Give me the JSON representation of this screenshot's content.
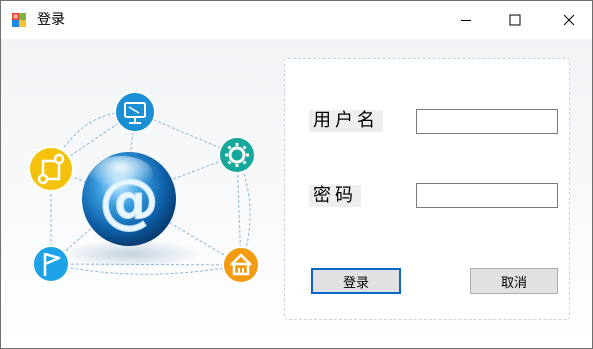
{
  "window": {
    "title": "登录",
    "controls": {
      "minimize_icon": "minimize-icon",
      "maximize_icon": "maximize-icon",
      "close_icon": "close-icon"
    }
  },
  "illustration": {
    "center_symbol": "@",
    "nodes": [
      "monitor-icon",
      "gear-icon",
      "home-icon",
      "flag-icon",
      "share-icon"
    ]
  },
  "form": {
    "username_label": "用户名",
    "username_value": "",
    "password_label": "密码",
    "password_value": "",
    "login_button": "登录",
    "cancel_button": "取消"
  },
  "colors": {
    "accent_border": "#0b64c8",
    "button_bg": "#e1e1e1",
    "node_blue": "#1a8fd6",
    "node_teal": "#16a89a",
    "node_orange": "#f39c12",
    "node_yellow": "#f4c20d",
    "node_lightblue": "#1fa3e8"
  }
}
